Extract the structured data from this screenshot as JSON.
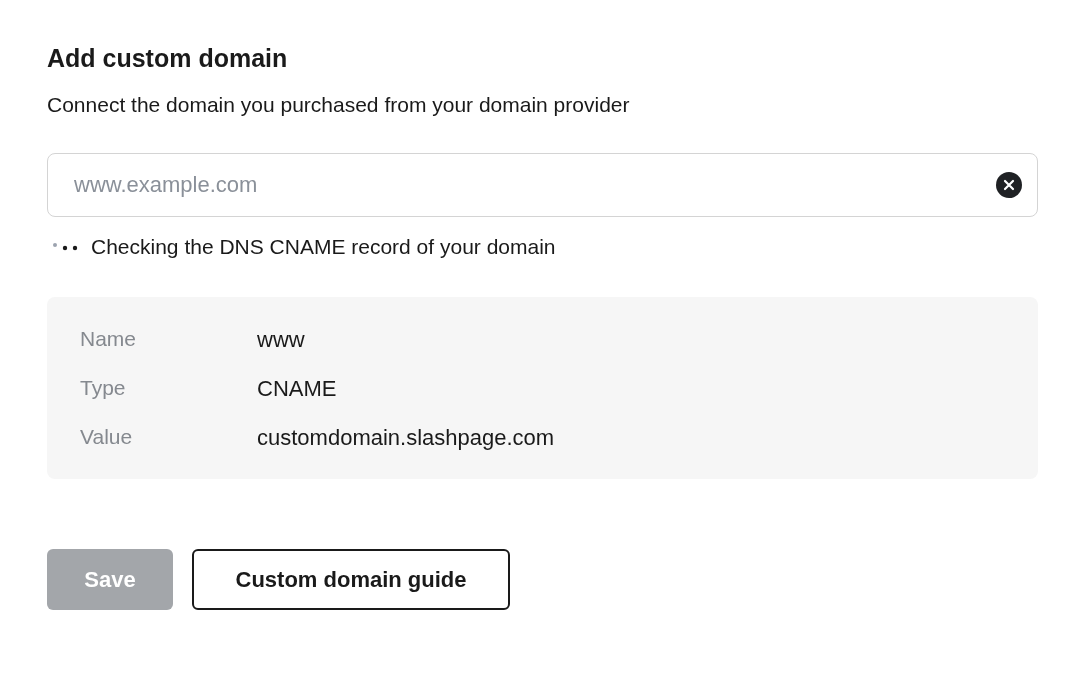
{
  "title": "Add custom domain",
  "subtitle": "Connect the domain you purchased from your domain provider",
  "domain_field": {
    "placeholder": "www.example.com"
  },
  "status": {
    "text": "Checking the DNS CNAME record of your domain",
    "loading": true
  },
  "records": [
    {
      "label": "Name",
      "value": "www"
    },
    {
      "label": "Type",
      "value": "CNAME"
    },
    {
      "label": "Value",
      "value": "customdomain.slashpage.com"
    }
  ],
  "buttons": [
    {
      "label": "Save",
      "kind": "primary",
      "disabled": true
    },
    {
      "label": "Custom domain guide",
      "kind": "outline",
      "disabled": false
    }
  ]
}
